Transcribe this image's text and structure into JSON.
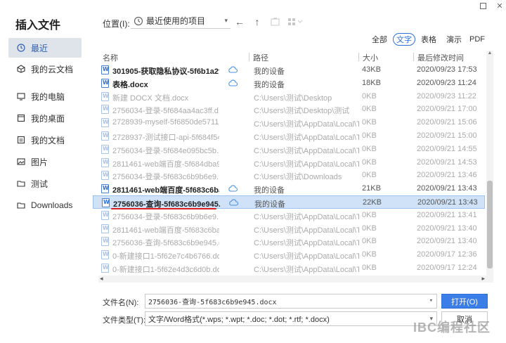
{
  "dialog": {
    "title": "插入文件"
  },
  "sidebar": {
    "items": [
      {
        "label": "最近",
        "icon": "clock-icon",
        "active": true
      },
      {
        "label": "我的云文档",
        "icon": "cloud-doc-icon"
      },
      {
        "label": "我的电脑",
        "icon": "computer-icon"
      },
      {
        "label": "我的桌面",
        "icon": "desktop-icon"
      },
      {
        "label": "我的文档",
        "icon": "documents-icon"
      },
      {
        "label": "图片",
        "icon": "image-icon"
      },
      {
        "label": "测试",
        "icon": "folder-icon"
      },
      {
        "label": "Downloads",
        "icon": "folder-icon"
      }
    ]
  },
  "location": {
    "label": "位置(I):",
    "value": "最近使用的项目"
  },
  "filters": {
    "tabs": [
      "全部",
      "文字",
      "表格",
      "演示",
      "PDF"
    ],
    "active": "文字"
  },
  "table": {
    "columns": [
      "名称",
      "路径",
      "大小",
      "最后修改时间"
    ],
    "rows": [
      {
        "name": "301905-获取隐私协议-5f6b1a2f3...",
        "path": "我的设备",
        "size": "43KB",
        "date": "2020/09/23 17:53",
        "cloud": true,
        "style": "strong"
      },
      {
        "name": "表格.docx",
        "path": "我的设备",
        "size": "18KB",
        "date": "2020/09/23 11:24",
        "cloud": true,
        "style": "strong"
      },
      {
        "name": "新建 DOCX 文档.docx",
        "path": "C:\\Users\\测试\\Desktop",
        "size": "0KB",
        "date": "2020/09/23 11:22",
        "cloud": false,
        "style": "dim"
      },
      {
        "name": "2756034-登录-5f684aa4ac3ff.d...",
        "path": "C:\\Users\\测试\\Desktop\\测试",
        "size": "0KB",
        "date": "2020/09/21 17:00",
        "cloud": false,
        "style": "dim"
      },
      {
        "name": "2728939-myself-5f6850de5711...",
        "path": "C:\\Users\\测试\\AppData\\Local\\T...",
        "size": "0KB",
        "date": "2020/09/21 15:06",
        "cloud": false,
        "style": "dim"
      },
      {
        "name": "2728937-测试接口-api-5f684f54...",
        "path": "C:\\Users\\测试\\AppData\\Local\\T...",
        "size": "0KB",
        "date": "2020/09/21 15:00",
        "cloud": false,
        "style": "dim"
      },
      {
        "name": "2756034-登录-5f684e095bc5b....",
        "path": "C:\\Users\\测试\\AppData\\Local\\T...",
        "size": "0KB",
        "date": "2020/09/21 14:55",
        "cloud": false,
        "style": "dim"
      },
      {
        "name": "2811461-web端百度-5f684dba9...",
        "path": "C:\\Users\\测试\\AppData\\Local\\T...",
        "size": "0KB",
        "date": "2020/09/21 14:53",
        "cloud": false,
        "style": "dim"
      },
      {
        "name": "2756034-登录-5f683c6b9b6e9....",
        "path": "C:\\Users\\测试\\Downloads",
        "size": "0KB",
        "date": "2020/09/21 13:46",
        "cloud": false,
        "style": "dim"
      },
      {
        "name": "2811461-web端百度-5f683c6ba...",
        "path": "我的设备",
        "size": "21KB",
        "date": "2020/09/21 13:43",
        "cloud": true,
        "style": "strong"
      },
      {
        "name": "2756036-查询-5f683c6b9e945.d...",
        "path": "我的设备",
        "size": "22KB",
        "date": "2020/09/21 13:43",
        "cloud": true,
        "style": "strong",
        "selected": true
      },
      {
        "name": "2756034-登录-5f683c6b9b6e9....",
        "path": "C:\\Users\\测试\\AppData\\Local\\T...",
        "size": "0KB",
        "date": "2020/09/21 13:41",
        "cloud": false,
        "style": "dim"
      },
      {
        "name": "2811461-web端百度-5f683c6ba...",
        "path": "C:\\Users\\测试\\AppData\\Local\\T...",
        "size": "0KB",
        "date": "2020/09/21 13:40",
        "cloud": false,
        "style": "dim"
      },
      {
        "name": "2756036-查询-5f683c6b9e945.d...",
        "path": "C:\\Users\\测试\\AppData\\Local\\T...",
        "size": "0KB",
        "date": "2020/09/21 13:40",
        "cloud": false,
        "style": "dim"
      },
      {
        "name": "0-新建接口1-5f62e7c4b6766.docx",
        "path": "C:\\Users\\测试\\AppData\\Local\\T...",
        "size": "0KB",
        "date": "2020/09/17 12:36",
        "cloud": false,
        "style": "dim"
      },
      {
        "name": "0-新建接口1-5f62e4d3c6d0b.do...",
        "path": "C:\\Users\\测试\\AppData\\Local\\T...",
        "size": "0KB",
        "date": "2020/09/17 12:24",
        "cloud": false,
        "style": "dim"
      }
    ]
  },
  "form": {
    "filename_label": "文件名(N):",
    "filename_value": "2756036-查询-5f683c6b9e945.docx",
    "filetype_label": "文件类型(T):",
    "filetype_value": "文字/Word格式(*.wps; *.wpt; *.doc; *.dot; *.rtf; *.docx)",
    "open_label": "打开(O)",
    "cancel_label": "取消"
  },
  "watermark": "IBC编程社区",
  "colors": {
    "accent": "#2f6fd8",
    "selected_row": "#cfe2f8",
    "annotation_underline": "#d81e1e"
  }
}
